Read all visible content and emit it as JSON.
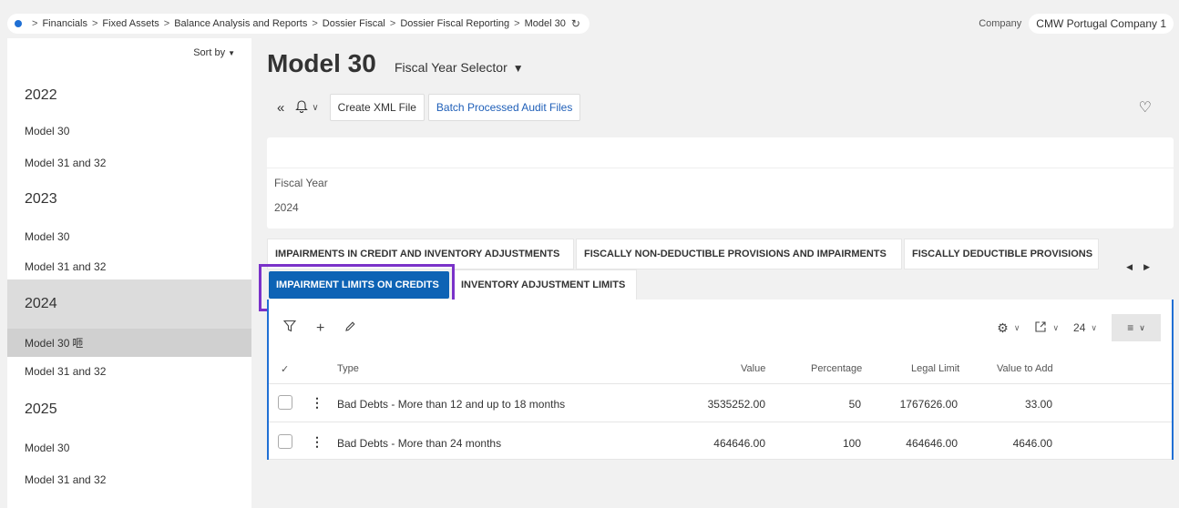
{
  "breadcrumb": {
    "items": [
      "Financials",
      "Fixed Assets",
      "Balance Analysis and Reports",
      "Dossier Fiscal",
      "Dossier Fiscal Reporting",
      "Model 30"
    ],
    "separator": ">"
  },
  "company": {
    "label": "Company",
    "value": "CMW Portugal Company 1"
  },
  "sidebar": {
    "sort_label": "Sort by",
    "groups": [
      {
        "year": "2022",
        "items": [
          "Model 30",
          "Model 31 and 32"
        ]
      },
      {
        "year": "2023",
        "items": [
          "Model 30",
          "Model 31 and 32"
        ]
      },
      {
        "year": "2024",
        "items": [
          "Model 30",
          "Model 31 and 32"
        ]
      },
      {
        "year": "2025",
        "items": [
          "Model 30",
          "Model 31 and 32"
        ]
      }
    ],
    "selected_marker": "咂"
  },
  "header": {
    "title": "Model 30",
    "selector_label": "Fiscal Year Selector"
  },
  "toolbar": {
    "create_xml": "Create XML File",
    "batch_audit": "Batch Processed Audit Files"
  },
  "fiscal_card": {
    "label": "Fiscal Year",
    "value": "2024"
  },
  "tabs": {
    "row1": [
      "IMPAIRMENTS IN CREDIT AND INVENTORY ADJUSTMENTS",
      "FISCALLY NON-DEDUCTIBLE PROVISIONS AND IMPAIRMENTS",
      "FISCALLY DEDUCTIBLE PROVISIONS"
    ],
    "row2": [
      "IMPAIRMENT LIMITS ON CREDITS",
      "INVENTORY ADJUSTMENT LIMITS"
    ],
    "active": "IMPAIRMENT LIMITS ON CREDITS"
  },
  "grid": {
    "page_size": "24",
    "columns": [
      "Type",
      "Value",
      "Percentage",
      "Legal Limit",
      "Value to Add"
    ],
    "rows": [
      {
        "type": "Bad Debts - More than 12 and up to 18 months",
        "value": "3535252.00",
        "percentage": "50",
        "legal_limit": "1767626.00",
        "value_to_add": "33.00"
      },
      {
        "type": "Bad Debts - More than 24 months",
        "value": "464646.00",
        "percentage": "100",
        "legal_limit": "464646.00",
        "value_to_add": "4646.00"
      }
    ]
  },
  "colors": {
    "accent": "#0d63b5",
    "highlight_frame": "#7a32c9",
    "selected_bg": "#d0d0d0"
  }
}
